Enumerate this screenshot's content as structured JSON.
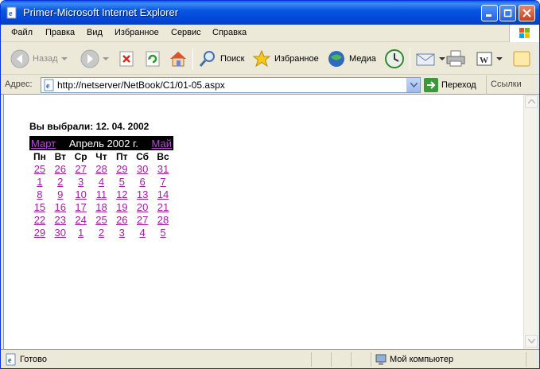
{
  "window": {
    "title": "Primer-Microsoft Internet Explorer"
  },
  "menu": [
    "Файл",
    "Правка",
    "Вид",
    "Избранное",
    "Сервис",
    "Справка"
  ],
  "toolbar": {
    "back": "Назад",
    "search": "Поиск",
    "favorites": "Избранное",
    "media": "Медиа"
  },
  "address": {
    "label": "Адрес:",
    "url": "http://netserver/NetBook/C1/01-05.aspx",
    "go": "Переход",
    "links": "Ссылки"
  },
  "page": {
    "selected": "Вы выбрали: 12. 04. 2002",
    "calendar": {
      "prev": "Март",
      "title": "Апрель 2002 г.",
      "next": "Май",
      "days_of_week": [
        "Пн",
        "Вт",
        "Ср",
        "Чт",
        "Пт",
        "Сб",
        "Вс"
      ],
      "weeks": [
        [
          "25",
          "26",
          "27",
          "28",
          "29",
          "30",
          "31"
        ],
        [
          "1",
          "2",
          "3",
          "4",
          "5",
          "6",
          "7"
        ],
        [
          "8",
          "9",
          "10",
          "11",
          "12",
          "13",
          "14"
        ],
        [
          "15",
          "16",
          "17",
          "18",
          "19",
          "20",
          "21"
        ],
        [
          "22",
          "23",
          "24",
          "25",
          "26",
          "27",
          "28"
        ],
        [
          "29",
          "30",
          "1",
          "2",
          "3",
          "4",
          "5"
        ]
      ]
    }
  },
  "status": {
    "text": "Готово",
    "zone": "Мой компьютер"
  },
  "colors": {
    "link": "#a020a0",
    "title_bar": "#0054e3",
    "calendar_header": "#000000"
  }
}
